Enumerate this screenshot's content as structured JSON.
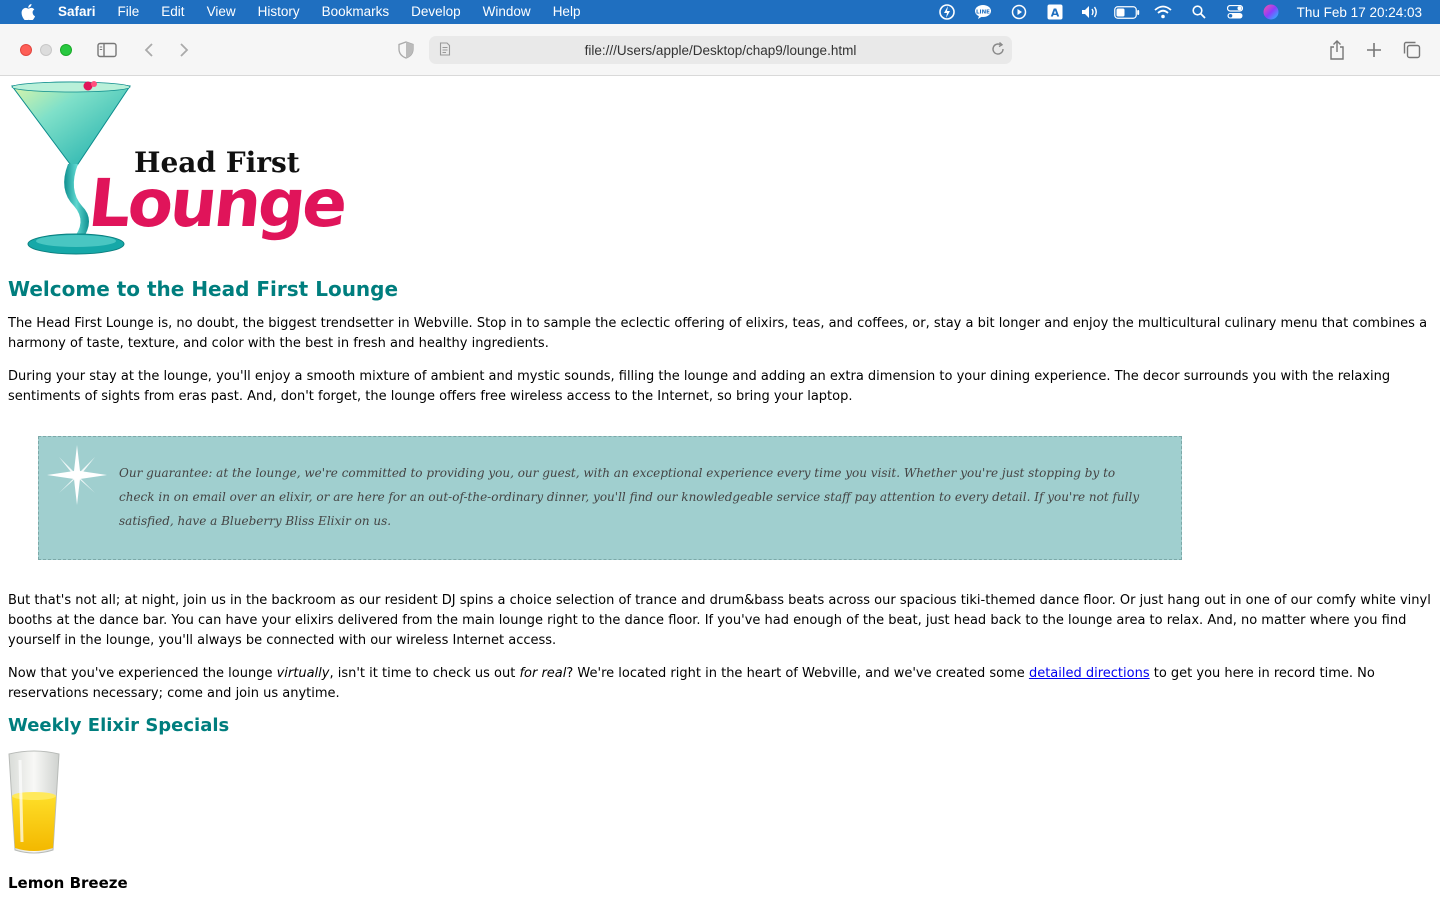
{
  "menubar": {
    "app_name": "Safari",
    "items": [
      "File",
      "Edit",
      "View",
      "History",
      "Bookmarks",
      "Develop",
      "Window",
      "Help"
    ],
    "clock": "Thu Feb 17  20:24:03",
    "status_icons": [
      "sync-icon",
      "line-icon",
      "play-icon",
      "input-a-icon",
      "volume-icon",
      "battery-icon",
      "wifi-icon",
      "search-icon",
      "control-center-icon",
      "siri-icon"
    ]
  },
  "toolbar": {
    "url": "file:///Users/apple/Desktop/chap9/lounge.html"
  },
  "page": {
    "logo_top_text": "Head First",
    "logo_main_text": "Lounge",
    "welcome_heading": "Welcome to the Head First Lounge",
    "p1": "The Head First Lounge is, no doubt, the biggest trendsetter in Webville. Stop in to sample the eclectic offering of elixirs, teas, and coffees, or, stay a bit longer and enjoy the multicultural culinary menu that combines a harmony of taste, texture, and color with the best in fresh and healthy ingredients.",
    "p2": "During your stay at the lounge, you'll enjoy a smooth mixture of ambient and mystic sounds, filling the lounge and adding an extra dimension to your dining experience. The decor surrounds you with the relaxing sentiments of sights from eras past. And, don't forget, the lounge offers free wireless access to the Internet, so bring your laptop.",
    "guarantee": "Our guarantee: at the lounge, we're committed to providing you, our guest, with an exceptional experience every time you visit. Whether you're just stopping by to check in on email over an elixir, or are here for an out-of-the-ordinary dinner, you'll find our knowledgeable service staff pay attention to every detail. If you're not fully satisfied, have a Blueberry Bliss Elixir on us.",
    "p3": "But that's not all; at night, join us in the backroom as our resident DJ spins a choice selection of trance and drum&bass beats across our spacious tiki-themed dance floor. Or just hang out in one of our comfy white vinyl booths at the dance bar. You can have your elixirs delivered from the main lounge right to the dance floor. If you've had enough of the beat, just head back to the lounge area to relax. And, no matter where you find yourself in the lounge, you'll always be connected with our wireless Internet access.",
    "p4_a": "Now that you've experienced the lounge ",
    "p4_em1": "virtually",
    "p4_b": ", isn't it time to check us out ",
    "p4_em2": "for real",
    "p4_c": "? We're located right in the heart of Webville, and we've created some ",
    "p4_link": "detailed directions",
    "p4_d": " to get you here in record time. No reservations necessary; come and join us anytime.",
    "specials_heading": "Weekly Elixir Specials",
    "drink_name": "Lemon Breeze"
  },
  "colors": {
    "heading": "#007e7e",
    "guarantee_bg": "#a0cfcf",
    "logo_pink": "#e0145a",
    "menubar_bg": "#1f6fc0"
  }
}
